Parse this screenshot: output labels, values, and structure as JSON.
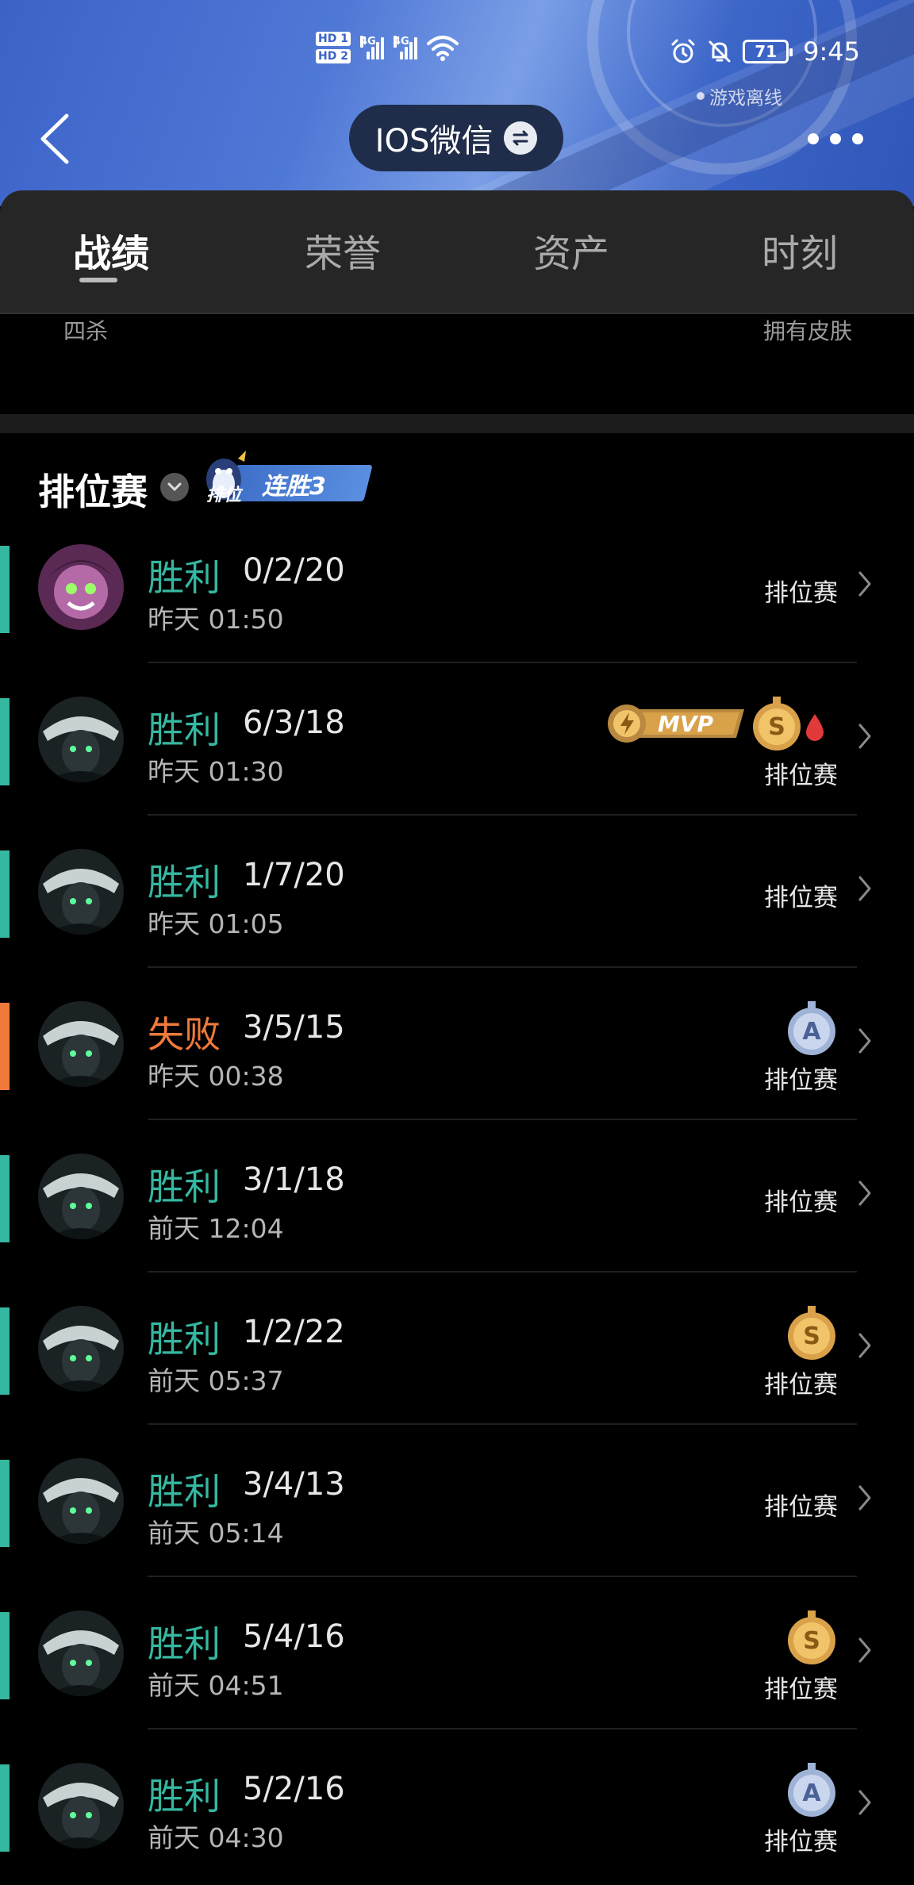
{
  "status_bar": {
    "hd1": "HD 1",
    "hd2": "HD 2",
    "net1": "4G",
    "net2": "4G",
    "battery": "71",
    "time": "9:45"
  },
  "header": {
    "offline_status": "游戏离线",
    "account_name": "IOS微信"
  },
  "tabs": [
    {
      "label": "战绩",
      "active": true
    },
    {
      "label": "荣誉",
      "active": false
    },
    {
      "label": "资产",
      "active": false
    },
    {
      "label": "时刻",
      "active": false
    }
  ],
  "stats": {
    "left_label": "四杀",
    "right_label": "拥有皮肤"
  },
  "section": {
    "title": "排位赛",
    "streak_rank": "排位",
    "streak_label": "连胜3"
  },
  "colors": {
    "win": "#35b7a0",
    "loss": "#f07a3a",
    "gold_medal": "#d9a24a",
    "silver_medal": "#9fb3d6"
  },
  "matches": [
    {
      "result": "胜利",
      "outcome": "win",
      "kda": "0/2/20",
      "time": "昨天 01:50",
      "mode": "排位赛",
      "hero": "pink-hero",
      "badges": []
    },
    {
      "result": "胜利",
      "outcome": "win",
      "kda": "6/3/18",
      "time": "昨天 01:30",
      "mode": "排位赛",
      "hero": "dark-hero",
      "badges": [
        "mvp",
        "s-medal",
        "first-blood"
      ],
      "mvp_text": "MVP",
      "s_text": "S"
    },
    {
      "result": "胜利",
      "outcome": "win",
      "kda": "1/7/20",
      "time": "昨天 01:05",
      "mode": "排位赛",
      "hero": "dark-hero",
      "badges": []
    },
    {
      "result": "失败",
      "outcome": "loss",
      "kda": "3/5/15",
      "time": "昨天 00:38",
      "mode": "排位赛",
      "hero": "dark-hero",
      "badges": [
        "a-medal"
      ],
      "a_text": "A"
    },
    {
      "result": "胜利",
      "outcome": "win",
      "kda": "3/1/18",
      "time": "前天 12:04",
      "mode": "排位赛",
      "hero": "dark-hero",
      "badges": []
    },
    {
      "result": "胜利",
      "outcome": "win",
      "kda": "1/2/22",
      "time": "前天 05:37",
      "mode": "排位赛",
      "hero": "dark-hero",
      "badges": [
        "s-medal"
      ],
      "s_text": "S"
    },
    {
      "result": "胜利",
      "outcome": "win",
      "kda": "3/4/13",
      "time": "前天 05:14",
      "mode": "排位赛",
      "hero": "dark-hero",
      "badges": []
    },
    {
      "result": "胜利",
      "outcome": "win",
      "kda": "5/4/16",
      "time": "前天 04:51",
      "mode": "排位赛",
      "hero": "dark-hero",
      "badges": [
        "s-medal"
      ],
      "s_text": "S"
    },
    {
      "result": "胜利",
      "outcome": "win",
      "kda": "5/2/16",
      "time": "前天 04:30",
      "mode": "排位赛",
      "hero": "dark-hero",
      "badges": [
        "a-medal"
      ],
      "a_text": "A"
    }
  ]
}
